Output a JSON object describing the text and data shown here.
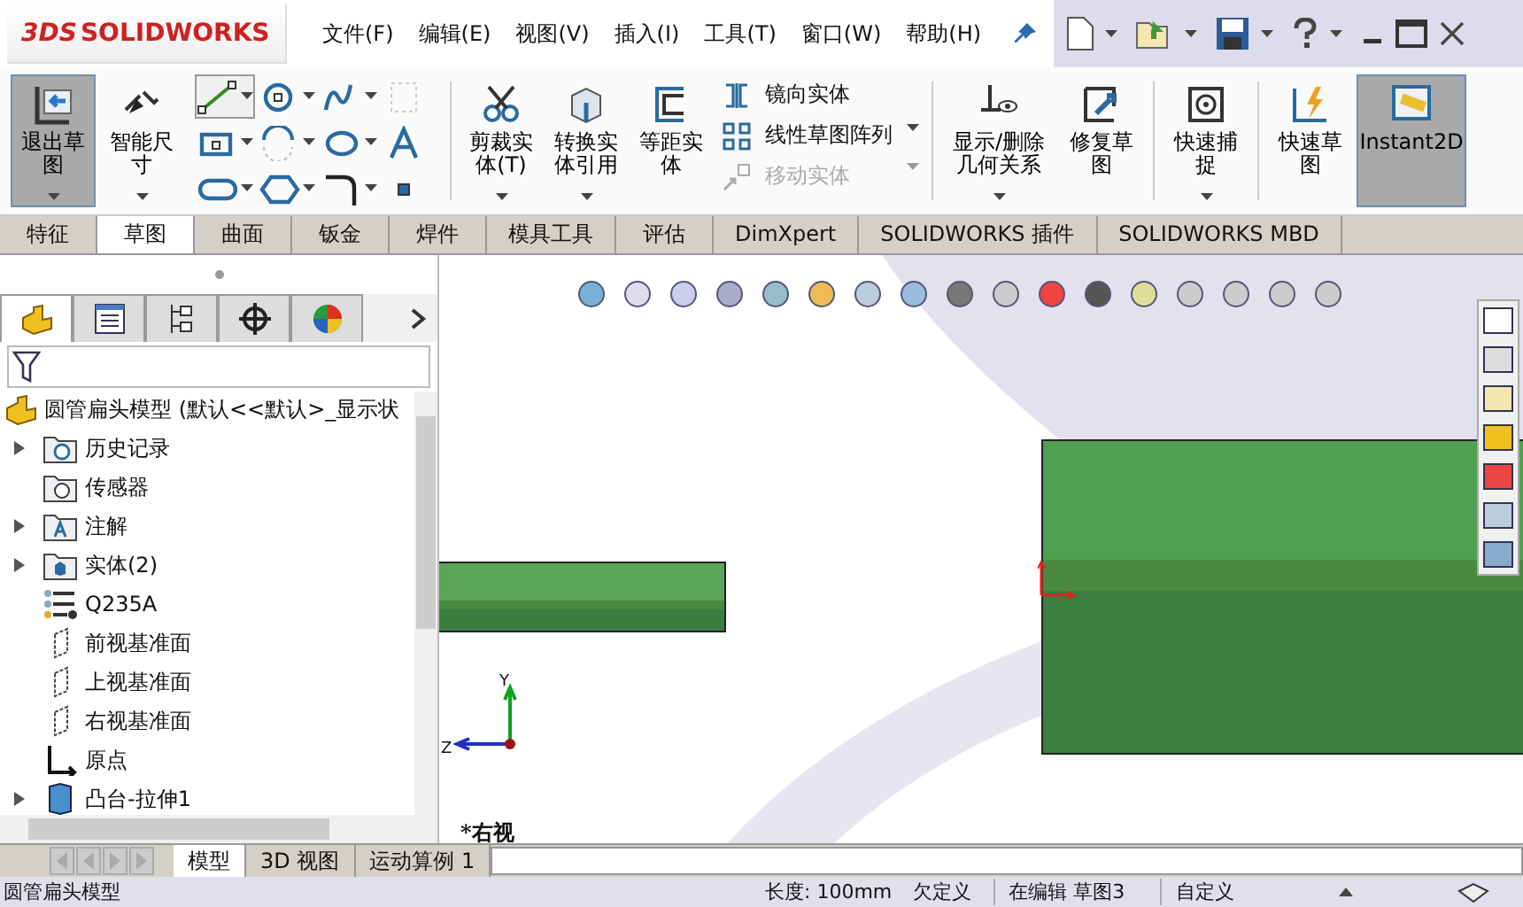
{
  "app": {
    "brand_prefix": "3DS",
    "brand": "SOLIDWORKS"
  },
  "menu": [
    {
      "label": "文件(F)"
    },
    {
      "label": "编辑(E)"
    },
    {
      "label": "视图(V)"
    },
    {
      "label": "插入(I)"
    },
    {
      "label": "工具(T)"
    },
    {
      "label": "窗口(W)"
    },
    {
      "label": "帮助(H)"
    }
  ],
  "ribbon": {
    "left": [
      {
        "label": "退出草图",
        "kind": "exit",
        "selected": true
      },
      {
        "label": "智能尺寸",
        "kind": "dimension",
        "selected": false
      }
    ],
    "tools": [
      {
        "kind": "line",
        "selected": true
      },
      {
        "kind": "circle",
        "selected": false
      },
      {
        "kind": "spline",
        "selected": false
      },
      {
        "kind": "grid",
        "selected": false
      },
      {
        "kind": "rect",
        "selected": false
      },
      {
        "kind": "arc",
        "selected": false
      },
      {
        "kind": "ellipse",
        "selected": false
      },
      {
        "kind": "text",
        "selected": false
      },
      {
        "kind": "slot",
        "selected": false
      },
      {
        "kind": "polygon",
        "selected": false
      },
      {
        "kind": "fillet",
        "selected": false
      },
      {
        "kind": "point",
        "selected": false
      }
    ],
    "middle": [
      {
        "label": "剪裁实体(T)",
        "kind": "trim"
      },
      {
        "label": "转换实体引用",
        "kind": "convert"
      },
      {
        "label": "等距实体",
        "kind": "offset"
      }
    ],
    "stack": [
      {
        "label": "镜向实体",
        "kind": "mirror",
        "disabled": false
      },
      {
        "label": "线性草图阵列",
        "kind": "pattern",
        "disabled": false
      },
      {
        "label": "移动实体",
        "kind": "move",
        "disabled": true
      }
    ],
    "right": [
      {
        "label": "显示/删除几何关系",
        "kind": "relations",
        "selected": false
      },
      {
        "label": "修复草图",
        "kind": "repair",
        "selected": false
      },
      {
        "label": "快速捕捉",
        "kind": "snap",
        "selected": false
      },
      {
        "label": "快速草图",
        "kind": "rapid",
        "selected": false
      },
      {
        "label": "Instant2D",
        "kind": "instant2d",
        "selected": true
      }
    ]
  },
  "tabs": [
    {
      "label": "特征",
      "selected": false
    },
    {
      "label": "草图",
      "selected": true
    },
    {
      "label": "曲面",
      "selected": false
    },
    {
      "label": "钣金",
      "selected": false
    },
    {
      "label": "焊件",
      "selected": false
    },
    {
      "label": "模具工具",
      "selected": false
    },
    {
      "label": "评估",
      "selected": false
    },
    {
      "label": "DimXpert",
      "selected": false
    },
    {
      "label": "SOLIDWORKS 插件",
      "selected": false
    },
    {
      "label": "SOLIDWORKS MBD",
      "selected": false
    }
  ],
  "panel_tabs": [
    {
      "kind": "features",
      "selected": true
    },
    {
      "kind": "properties",
      "selected": false
    },
    {
      "kind": "configurations",
      "selected": false
    },
    {
      "kind": "dimxpert",
      "selected": false
    },
    {
      "kind": "display",
      "selected": false
    }
  ],
  "tree": {
    "root": "圆管扁头模型  (默认<<默认>_显示状",
    "items": [
      {
        "label": "历史记录",
        "kind": "history",
        "expandable": true
      },
      {
        "label": "传感器",
        "kind": "sensor",
        "expandable": false
      },
      {
        "label": "注解",
        "kind": "annotation",
        "expandable": true
      },
      {
        "label": "实体(2)",
        "kind": "solid",
        "expandable": true
      },
      {
        "label": "Q235A",
        "kind": "material",
        "expandable": false
      },
      {
        "label": "前视基准面",
        "kind": "plane",
        "expandable": false
      },
      {
        "label": "上视基准面",
        "kind": "plane",
        "expandable": false
      },
      {
        "label": "右视基准面",
        "kind": "plane",
        "expandable": false
      },
      {
        "label": "原点",
        "kind": "origin",
        "expandable": false
      },
      {
        "label": "凸台-拉伸1",
        "kind": "extrude",
        "expandable": true
      }
    ]
  },
  "viewport": {
    "view_label": "*右视",
    "axis_y": "Y",
    "axis_z": "Z"
  },
  "bottom_tabs": [
    {
      "label": "模型",
      "selected": true
    },
    {
      "label": "3D 视图",
      "selected": false
    },
    {
      "label": "运动算例 1",
      "selected": false
    }
  ],
  "status_bar": {
    "document": "圆管扁头模型",
    "length": "长度: 100mm",
    "state": "欠定义",
    "editing": "在编辑 草图3",
    "units": "自定义"
  }
}
